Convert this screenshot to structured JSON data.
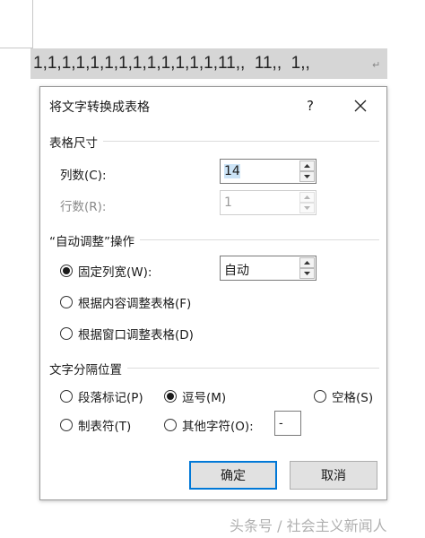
{
  "document": {
    "line_text": "1,1,1,1,1,1,1,1,1,1,1,1,1,11,,  11,,  1,,",
    "paragraph_mark": "↵"
  },
  "dialog": {
    "title": "将文字转换成表格",
    "help_label": "?",
    "close_label": "✕",
    "table_size": {
      "heading": "表格尺寸",
      "columns_label": "列数(C):",
      "columns_value": "14",
      "rows_label": "行数(R):",
      "rows_value": "1"
    },
    "autofit": {
      "heading": "“自动调整”操作",
      "fixed_width_label": "固定列宽(W):",
      "fixed_width_value": "自动",
      "fit_contents_label": "根据内容调整表格(F)",
      "fit_window_label": "根据窗口调整表格(D)"
    },
    "separator": {
      "heading": "文字分隔位置",
      "paragraph_label": "段落标记(P)",
      "comma_label": "逗号(M)",
      "space_label": "空格(S)",
      "tab_label": "制表符(T)",
      "other_label": "其他字符(O):",
      "other_value": "-"
    },
    "buttons": {
      "ok_label": "确定",
      "cancel_label": "取消"
    }
  },
  "watermark": "头条号 / 社会主义新闻人",
  "colors": {
    "highlight": "#d6d6d6",
    "default_button_border": "#0078d7",
    "selection": "#cce4f7"
  }
}
